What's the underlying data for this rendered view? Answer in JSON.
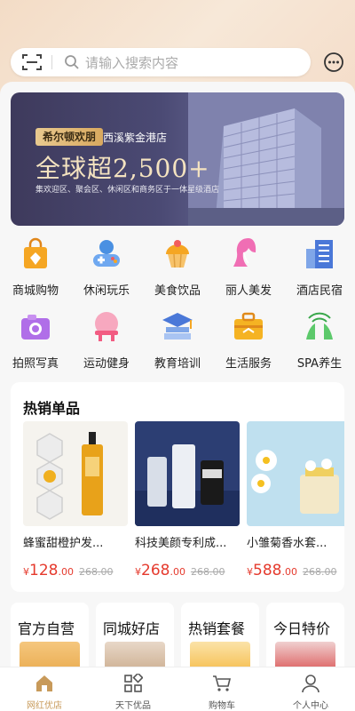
{
  "search": {
    "placeholder": "请输入搜索内容"
  },
  "banner": {
    "tag": "希尔顿欢朋",
    "store": "西溪紫金港店",
    "headline": "全球超2,500+",
    "subtitle": "集欢迎区、聚会区、休闲区和商务区于一体星级酒店"
  },
  "categories": [
    {
      "label": "商城购物",
      "icon": "shopping-bag-icon"
    },
    {
      "label": "休闲玩乐",
      "icon": "gamepad-icon"
    },
    {
      "label": "美食饮品",
      "icon": "cupcake-icon"
    },
    {
      "label": "丽人美发",
      "icon": "beauty-icon"
    },
    {
      "label": "酒店民宿",
      "icon": "hotel-icon"
    },
    {
      "label": "拍照写真",
      "icon": "camera-icon"
    },
    {
      "label": "运动健身",
      "icon": "fitness-icon"
    },
    {
      "label": "教育培训",
      "icon": "education-icon"
    },
    {
      "label": "生活服务",
      "icon": "toolbox-icon"
    },
    {
      "label": "SPA养生",
      "icon": "spa-icon"
    }
  ],
  "hot": {
    "title": "热销单品",
    "products": [
      {
        "name": "蜂蜜甜橙护发...",
        "currency": "¥",
        "price": "128",
        "cents": ".00",
        "old": "268.00"
      },
      {
        "name": "科技美颜专利成...",
        "currency": "¥",
        "price": "268",
        "cents": ".00",
        "old": "268.00"
      },
      {
        "name": "小雏菊香水套...",
        "currency": "¥",
        "price": "588",
        "cents": ".00",
        "old": "268.00"
      }
    ]
  },
  "promos": [
    {
      "title": "官方自营"
    },
    {
      "title": "同城好店"
    },
    {
      "title": "热销套餐"
    },
    {
      "title": "今日特价"
    }
  ],
  "tabs": [
    {
      "label": "网红优店",
      "icon": "home-icon",
      "active": true
    },
    {
      "label": "天下优品",
      "icon": "grid-icon",
      "active": false
    },
    {
      "label": "购物车",
      "icon": "cart-icon",
      "active": false
    },
    {
      "label": "个人中心",
      "icon": "user-icon",
      "active": false
    }
  ],
  "colors": {
    "accent": "#c89a5a",
    "price": "#e53a2d"
  }
}
